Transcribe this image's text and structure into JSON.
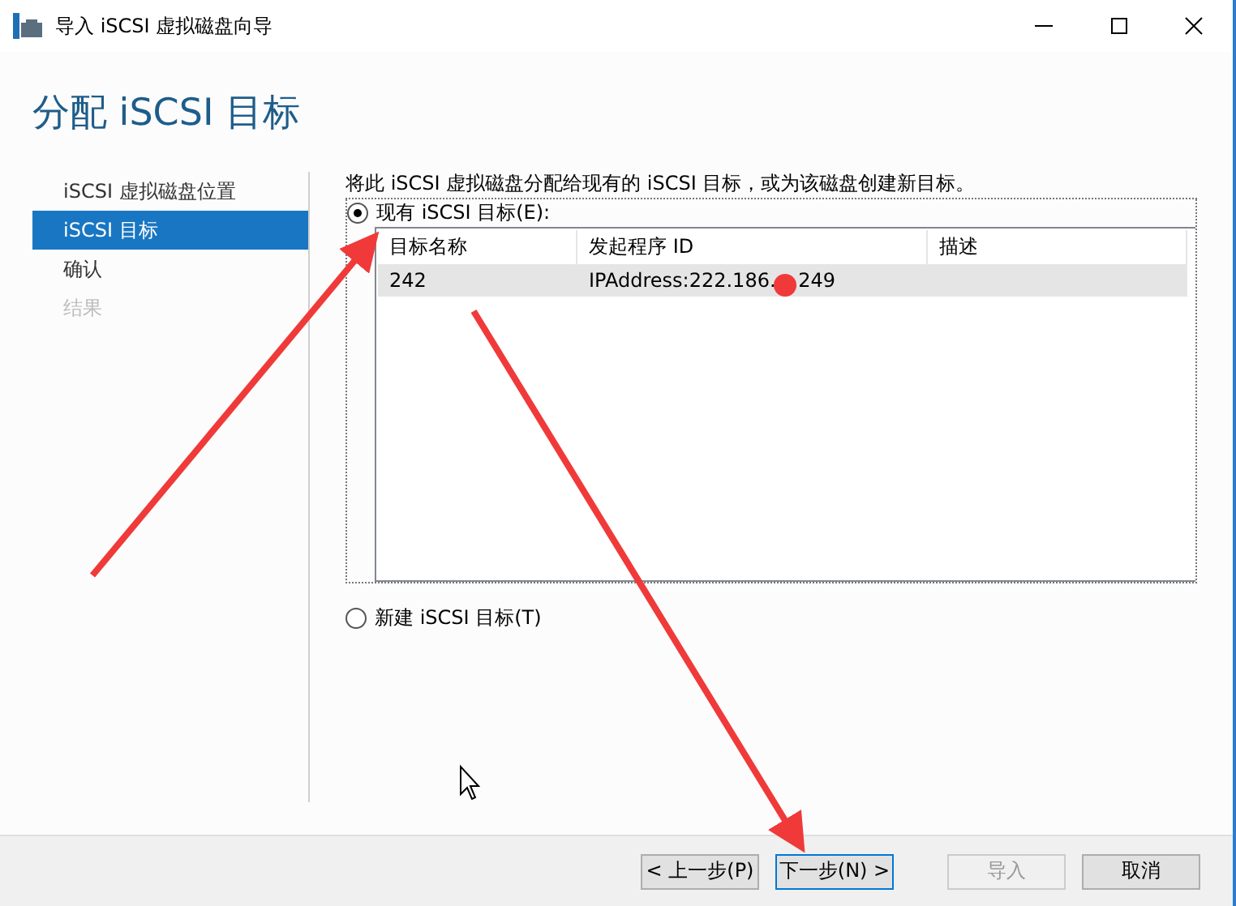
{
  "window": {
    "title": "导入 iSCSI 虚拟磁盘向导"
  },
  "heading": "分配 iSCSI 目标",
  "steps": [
    {
      "label": "iSCSI 虚拟磁盘位置",
      "selected": false,
      "disabled": false
    },
    {
      "label": "iSCSI 目标",
      "selected": true,
      "disabled": false
    },
    {
      "label": "确认",
      "selected": false,
      "disabled": false
    },
    {
      "label": "结果",
      "selected": false,
      "disabled": true
    }
  ],
  "description": "将此 iSCSI 虚拟磁盘分配给现有的 iSCSI 目标，或为该磁盘创建新目标。",
  "options": [
    {
      "label": "现有 iSCSI 目标(E):",
      "selected": true
    },
    {
      "label": "新建 iSCSI 目标(T)",
      "selected": false
    }
  ],
  "table": {
    "columns": [
      "目标名称",
      "发起程序 ID",
      "描述"
    ],
    "rows": [
      {
        "cells": [
          "242",
          "IPAddress:222.186."
        ],
        "cell_tail": ".249",
        "redacted": true,
        "selected": true
      }
    ]
  },
  "buttons": [
    {
      "label": "< 上一步(P)",
      "disabled": false,
      "default": false
    },
    {
      "label": "下一步(N) >",
      "disabled": false,
      "default": true
    },
    {
      "label": "导入",
      "disabled": true,
      "default": false
    },
    {
      "label": "取消",
      "disabled": false,
      "default": false
    }
  ]
}
